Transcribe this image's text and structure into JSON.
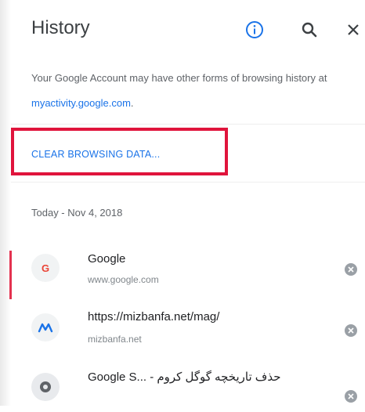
{
  "header": {
    "title": "History",
    "info_icon": "info-icon",
    "search_icon": "search-icon",
    "close_icon": "close-icon"
  },
  "info": {
    "text_before": "Your Google Account may have other forms of browsing history at ",
    "link": "myactivity.google.com",
    "text_after": "."
  },
  "clear_button": "CLEAR BROWSING DATA...",
  "date_header": "Today - Nov 4, 2018",
  "entries": [
    {
      "icon_letter": "G",
      "icon_color": "#ea4335",
      "title": "Google",
      "url": "www.google.com"
    },
    {
      "icon_letter": "M",
      "icon_color": "#1a73e8",
      "title": "https://mizbanfa.net/mag/",
      "url": "mizbanfa.net"
    },
    {
      "icon_letter": "",
      "icon_color": "#5f6368",
      "title": "Google S... - حذف تاریخچه گوگل کروم",
      "url": ""
    }
  ],
  "colors": {
    "accent": "#1a73e8",
    "highlight": "#e0143c",
    "left_marker": "#e3324f"
  }
}
